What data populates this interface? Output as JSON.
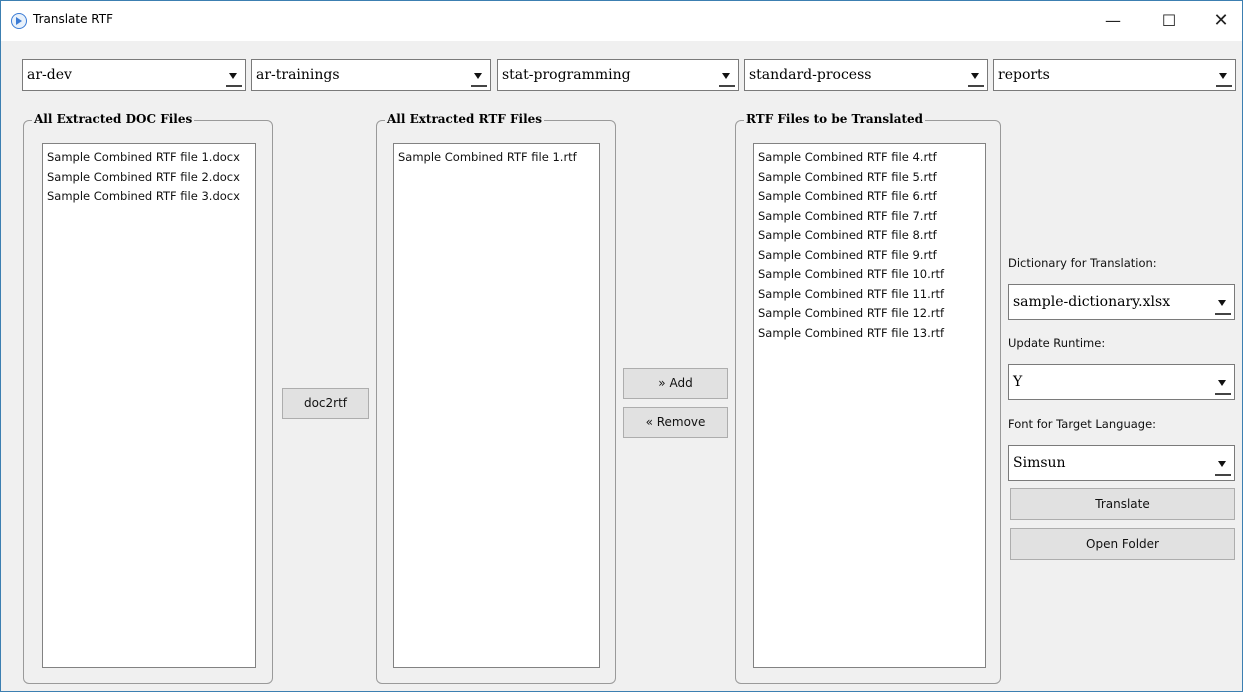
{
  "window": {
    "title": "Translate RTF",
    "minimize": "—",
    "maximize": "☐",
    "close": "✕"
  },
  "dropdowns": [
    {
      "value": "ar-dev"
    },
    {
      "value": "ar-trainings"
    },
    {
      "value": "stat-programming"
    },
    {
      "value": "standard-process"
    },
    {
      "value": "reports"
    }
  ],
  "doc_group": {
    "title": "All Extracted DOC Files",
    "items": [
      "Sample Combined RTF file 1.docx",
      "Sample Combined RTF file 2.docx",
      "Sample Combined RTF file 3.docx"
    ]
  },
  "doc2rtf_label": "doc2rtf",
  "rtf_group": {
    "title": "All Extracted RTF Files",
    "items": [
      "Sample Combined RTF file 1.rtf"
    ]
  },
  "add_label": "» Add",
  "remove_label": "« Remove",
  "translate_group": {
    "title": "RTF Files to be Translated",
    "items": [
      "Sample Combined RTF file 4.rtf",
      "Sample Combined RTF file 5.rtf",
      "Sample Combined RTF file 6.rtf",
      "Sample Combined RTF file 7.rtf",
      "Sample Combined RTF file 8.rtf",
      "Sample Combined RTF file 9.rtf",
      "Sample Combined RTF file 10.rtf",
      "Sample Combined RTF file 11.rtf",
      "Sample Combined RTF file 12.rtf",
      "Sample Combined RTF file 13.rtf"
    ]
  },
  "options": {
    "dictionary_label": "Dictionary for Translation:",
    "dictionary_value": "sample-dictionary.xlsx",
    "runtime_label": "Update Runtime:",
    "runtime_value": "Y",
    "font_label": "Font for Target Language:",
    "font_value": "Simsun",
    "translate_button": "Translate",
    "open_folder_button": "Open Folder"
  }
}
